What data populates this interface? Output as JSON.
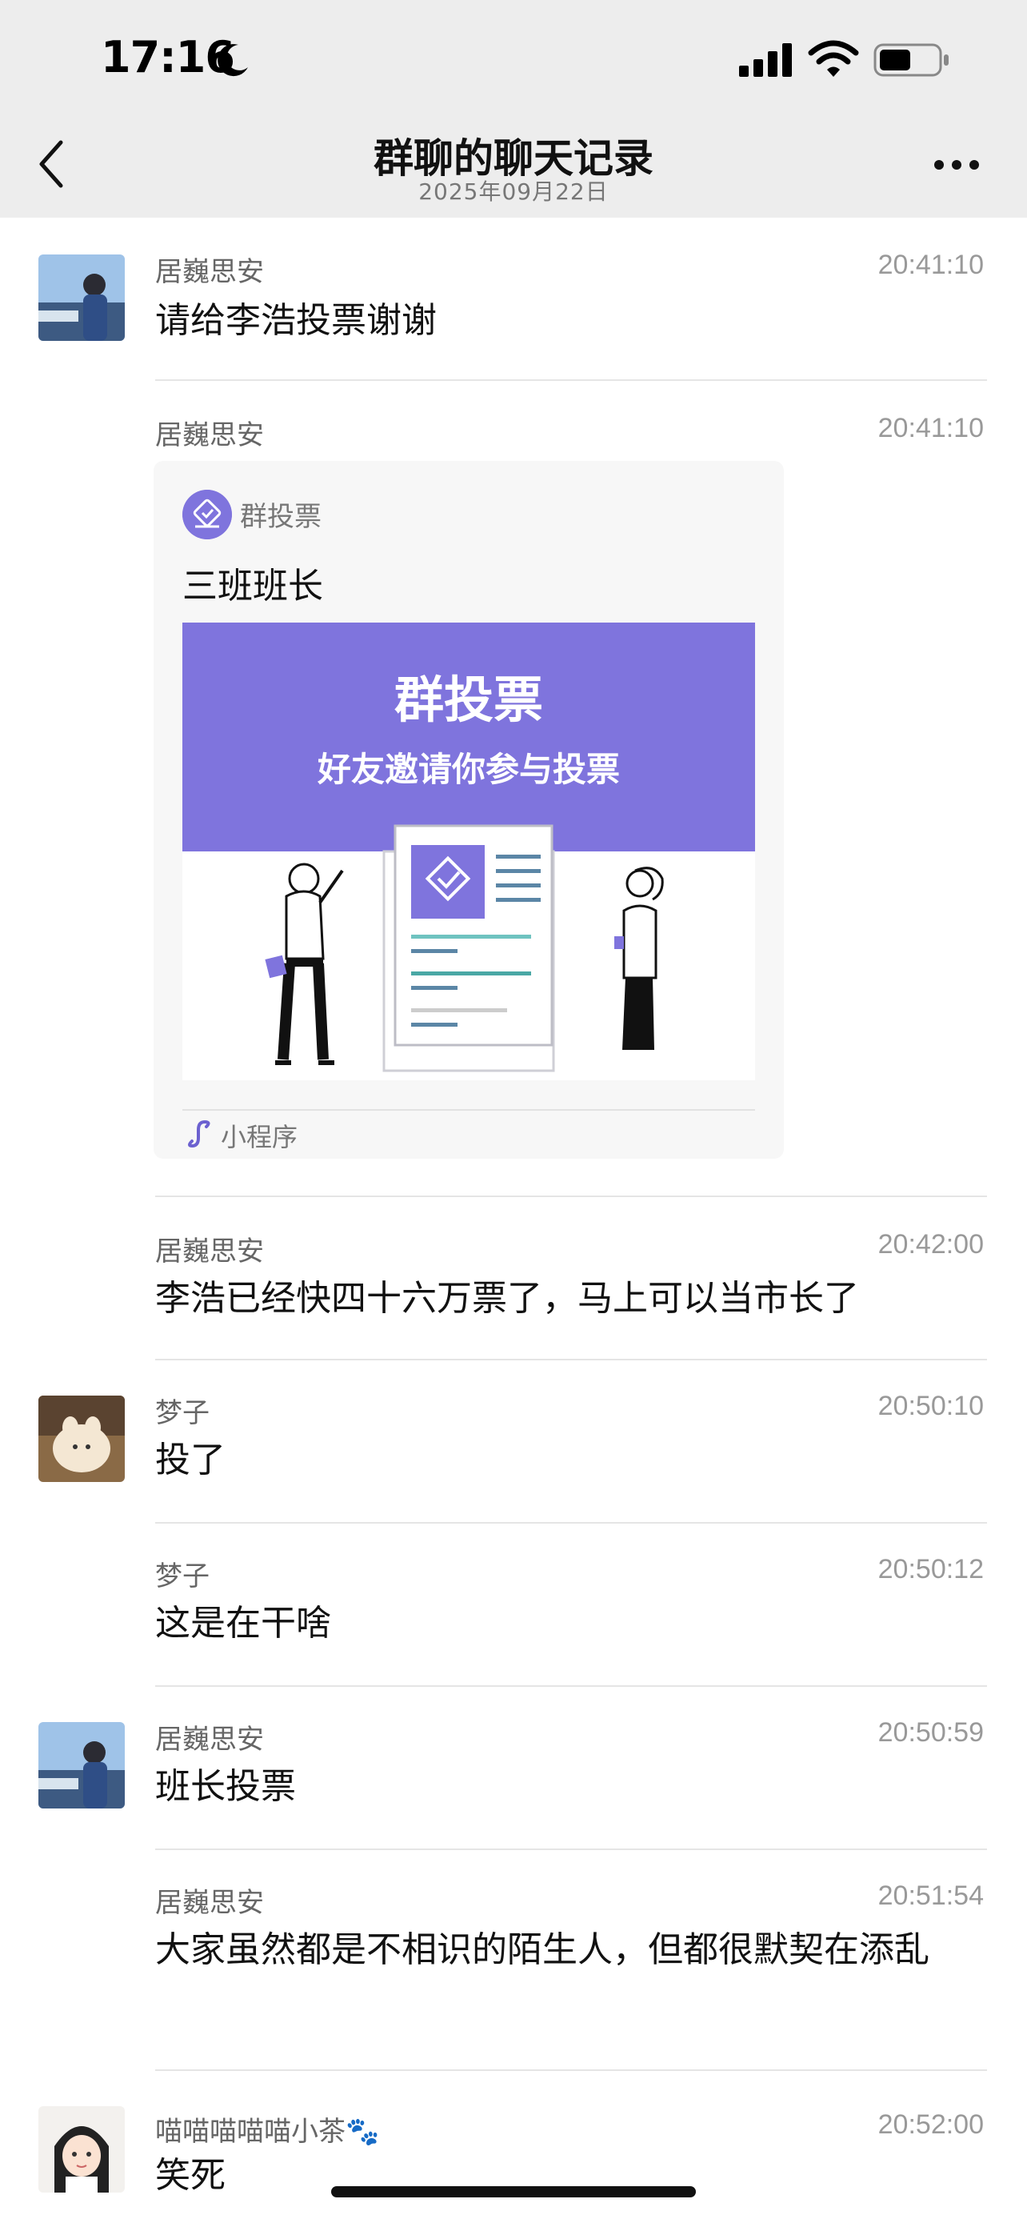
{
  "status_bar": {
    "time": "17:16",
    "icons": [
      "moon-icon",
      "signal-icon",
      "wifi-icon",
      "battery-icon"
    ]
  },
  "nav": {
    "title": "群聊的聊天记录",
    "subtitle": "2025年09月22日",
    "back_icon": "chevron-left-icon",
    "more_icon": "more-icon"
  },
  "messages": [
    {
      "sender": "居巍思安",
      "time": "20:41:10",
      "text": "请给李浩投票谢谢"
    },
    {
      "sender": "居巍思安",
      "time": "20:41:10",
      "card": {
        "app": "群投票",
        "title": "三班班长",
        "banner_title": "群投票",
        "banner_subtitle": "好友邀请你参与投票",
        "footer": "小程序"
      }
    },
    {
      "sender": "居巍思安",
      "time": "20:42:00",
      "text": "李浩已经快四十六万票了，马上可以当市长了"
    },
    {
      "sender": "梦子",
      "time": "20:50:10",
      "text": "投了"
    },
    {
      "sender": "梦子",
      "time": "20:50:12",
      "text": "这是在干啥"
    },
    {
      "sender": "居巍思安",
      "time": "20:50:59",
      "text": "班长投票"
    },
    {
      "sender": "居巍思安",
      "time": "20:51:54",
      "text": "大家虽然都是不相识的陌生人，但都很默契在添乱"
    },
    {
      "sender": "喵喵喵喵喵小茶🐾",
      "time": "20:52:00",
      "text": "笑死"
    }
  ],
  "colors": {
    "accent": "#7f74dd",
    "nav_bg": "#ededed",
    "divider": "#e5e5e5"
  }
}
